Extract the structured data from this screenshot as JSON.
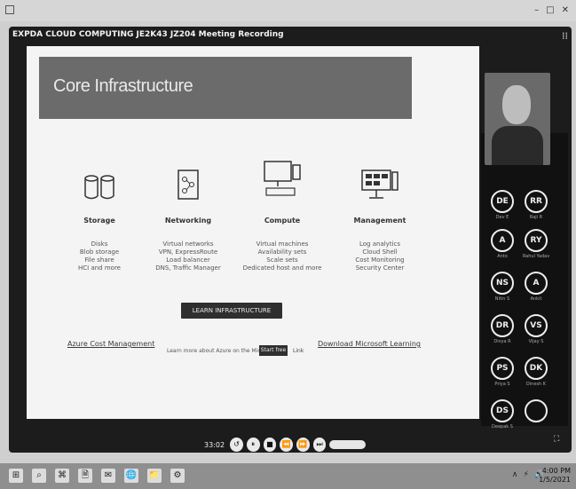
{
  "window": {
    "title": "EXPDA CLOUD COMPUTING JE2K43 JZ204 Meeting Recording",
    "controls": [
      "–",
      "□",
      "✕"
    ]
  },
  "slide": {
    "title": "Core Infrastructure",
    "watermark": "",
    "columns": [
      {
        "head": "Storage",
        "lines": [
          "Disks",
          "Blob storage",
          "File share",
          "HCI and more"
        ],
        "icon": "storage-icon"
      },
      {
        "head": "Networking",
        "lines": [
          "Virtual networks",
          "VPN, ExpressRoute",
          "Load balancer",
          "DNS, Traffic Manager"
        ],
        "icon": "networking-icon"
      },
      {
        "head": "Compute",
        "lines": [
          "Virtual machines",
          "Availability sets",
          "Scale sets",
          "Dedicated host and more"
        ],
        "icon": "compute-icon"
      },
      {
        "head": "Management",
        "lines": [
          "Log analytics",
          "Cloud Shell",
          "Cost Monitoring",
          "Security Center"
        ],
        "icon": "management-icon"
      }
    ],
    "cta_button": "LEARN INFRASTRUCTURE",
    "link_left": "Azure Cost Management",
    "note_text": "Learn more about Azure on the Microsoft site",
    "note_button": "Start free",
    "note_link": "Link",
    "link_right": "Download Microsoft Learning"
  },
  "participants": [
    {
      "initials": "DE",
      "name": "Dev E"
    },
    {
      "initials": "RR",
      "name": "Raji R"
    },
    {
      "initials": "A",
      "name": "Anto"
    },
    {
      "initials": "RY",
      "name": "Rahul Yadav"
    },
    {
      "initials": "NS",
      "name": "Nitin S"
    },
    {
      "initials": "A",
      "name": "Ankit"
    },
    {
      "initials": "DR",
      "name": "Divya R"
    },
    {
      "initials": "VS",
      "name": "Vijay S"
    },
    {
      "initials": "PS",
      "name": "Priya S"
    },
    {
      "initials": "DK",
      "name": "Dinesh K"
    },
    {
      "initials": "DS",
      "name": "Deepak S"
    },
    {
      "initials": "",
      "name": ""
    }
  ],
  "player": {
    "time": "33:02",
    "controls": [
      "↺",
      "⏸",
      "■",
      "⏪",
      "⏩",
      "⏭"
    ]
  },
  "taskbar": {
    "icons": [
      "⊞",
      "⌕",
      "⌘",
      "🗎",
      "✉",
      "🌐",
      "📁",
      "⚙"
    ],
    "tray": [
      "∧",
      "⚡",
      "🔊"
    ],
    "time": "4:00 PM",
    "date": "1/5/2021"
  }
}
